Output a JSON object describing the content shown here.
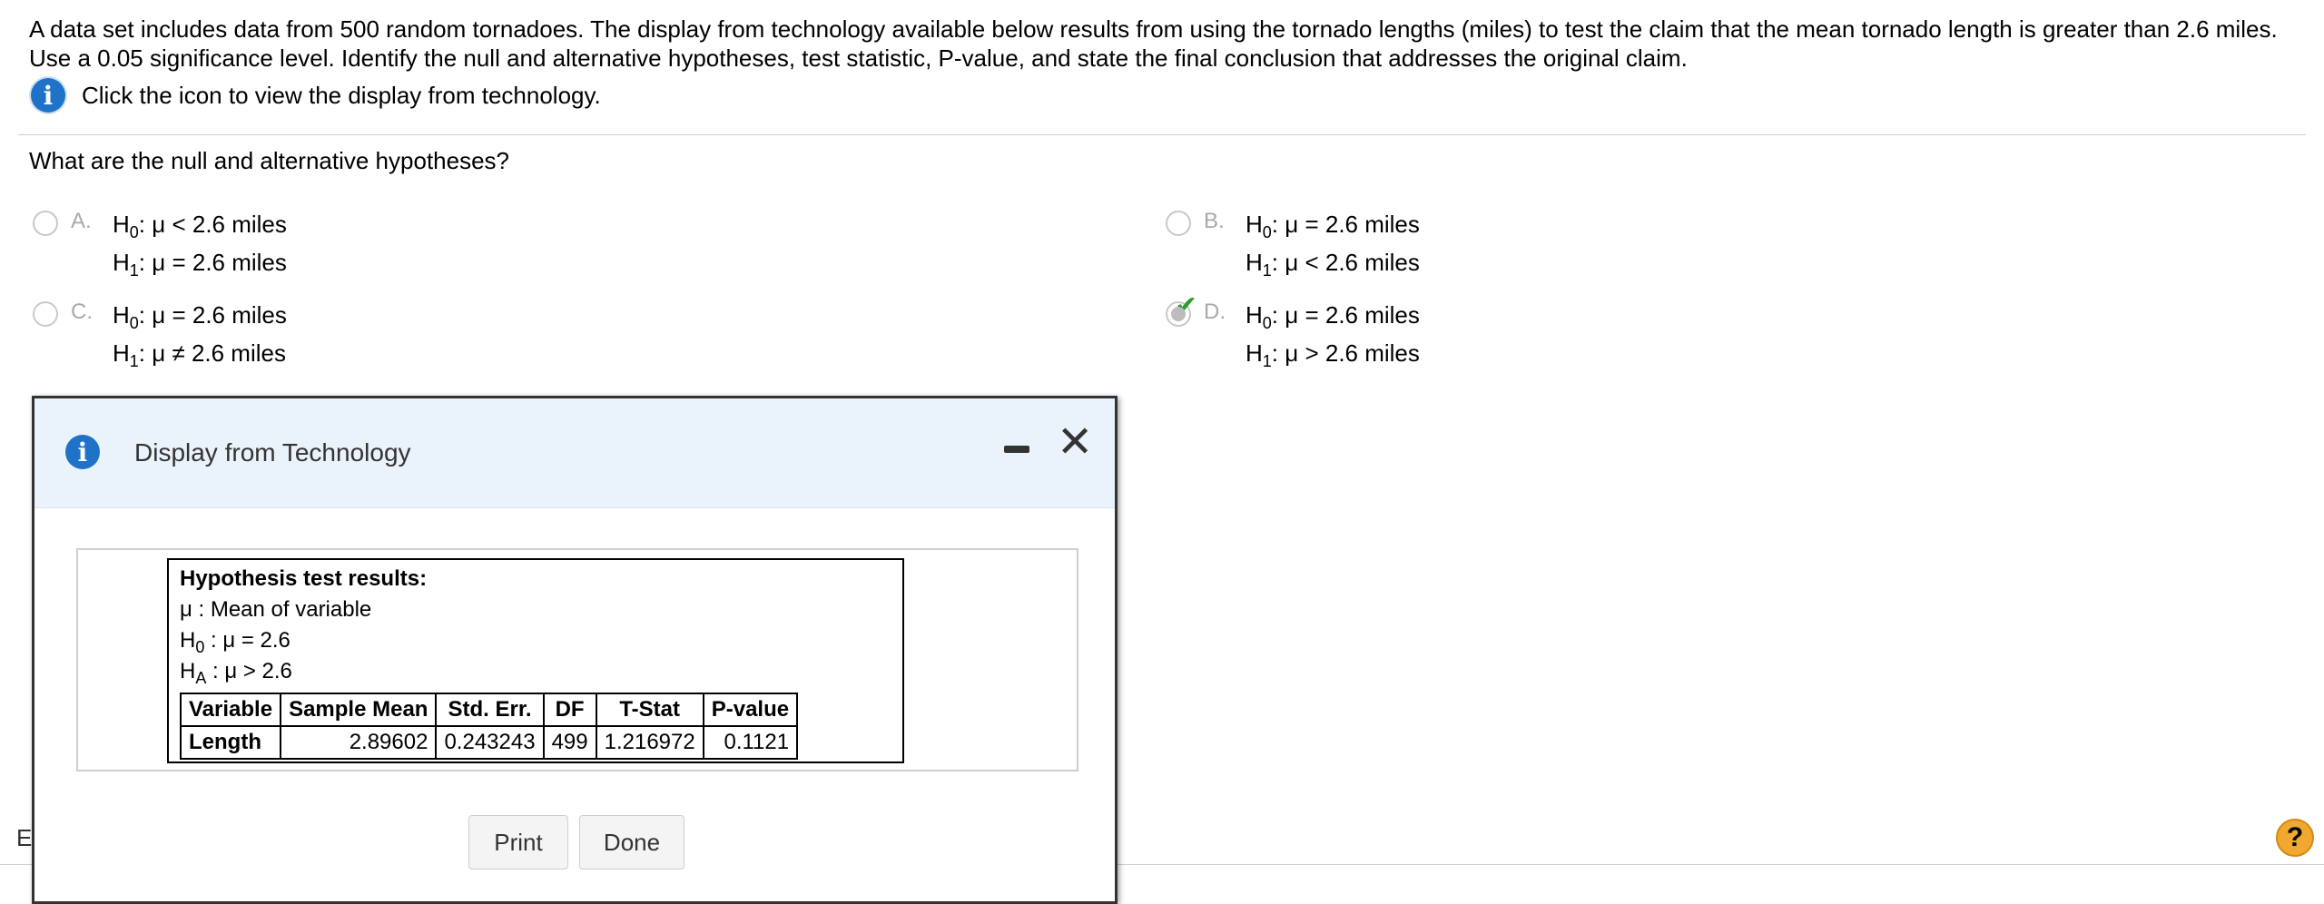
{
  "question": {
    "line1": "A data set includes data from 500 random tornadoes. The display from technology available below results from using the tornado lengths (miles) to test the claim that the mean tornado length is greater than 2.6 miles.",
    "line2": "Use a 0.05 significance level. Identify the null and alternative hypotheses, test statistic, P-value, and state the final conclusion that addresses the original claim.",
    "hint": "Click the icon to view the display from technology.",
    "hint_icon": "info-icon",
    "subquestion": "What are the null and alternative hypotheses?"
  },
  "options": [
    {
      "letter": "A.",
      "h0_prefix": "H",
      "h0_sub": "0",
      "h0_rel": ": μ < 2.6 miles",
      "h1_prefix": "H",
      "h1_sub": "1",
      "h1_rel": ": μ = 2.6 miles",
      "selected": false
    },
    {
      "letter": "B.",
      "h0_prefix": "H",
      "h0_sub": "0",
      "h0_rel": ": μ = 2.6 miles",
      "h1_prefix": "H",
      "h1_sub": "1",
      "h1_rel": ": μ < 2.6 miles",
      "selected": false
    },
    {
      "letter": "C.",
      "h0_prefix": "H",
      "h0_sub": "0",
      "h0_rel": ": μ = 2.6 miles",
      "h1_prefix": "H",
      "h1_sub": "1",
      "h1_rel": ": μ ≠ 2.6 miles",
      "selected": false
    },
    {
      "letter": "D.",
      "h0_prefix": "H",
      "h0_sub": "0",
      "h0_rel": ": μ = 2.6 miles",
      "h1_prefix": "H",
      "h1_sub": "1",
      "h1_rel": ": μ > 2.6 miles",
      "selected": true
    }
  ],
  "dialog": {
    "title": "Display from Technology",
    "icon": "info-icon",
    "minimize_icon": "minimize-icon",
    "close_icon": "close-icon",
    "print_label": "Print",
    "done_label": "Done"
  },
  "tech": {
    "heading": "Hypothesis test results:",
    "mu_line": "μ : Mean of variable",
    "h0_prefix": "H",
    "h0_sub": "0",
    "h0_rel": " : μ = 2.6",
    "ha_prefix": "H",
    "ha_sub": "A",
    "ha_rel": " : μ > 2.6",
    "table": {
      "headers": [
        "Variable",
        "Sample Mean",
        "Std. Err.",
        "DF",
        "T-Stat",
        "P-value"
      ],
      "row": [
        "Length",
        "2.89602",
        "0.243243",
        "499",
        "1.216972",
        "0.1121"
      ]
    }
  },
  "footer": {
    "truncated_text": "E",
    "help_label": "?"
  },
  "colors": {
    "info_blue": "#1e73c8",
    "check_green": "#2e9b2e",
    "dialog_header": "#eaf2fb",
    "help_orange": "#f0a830"
  }
}
